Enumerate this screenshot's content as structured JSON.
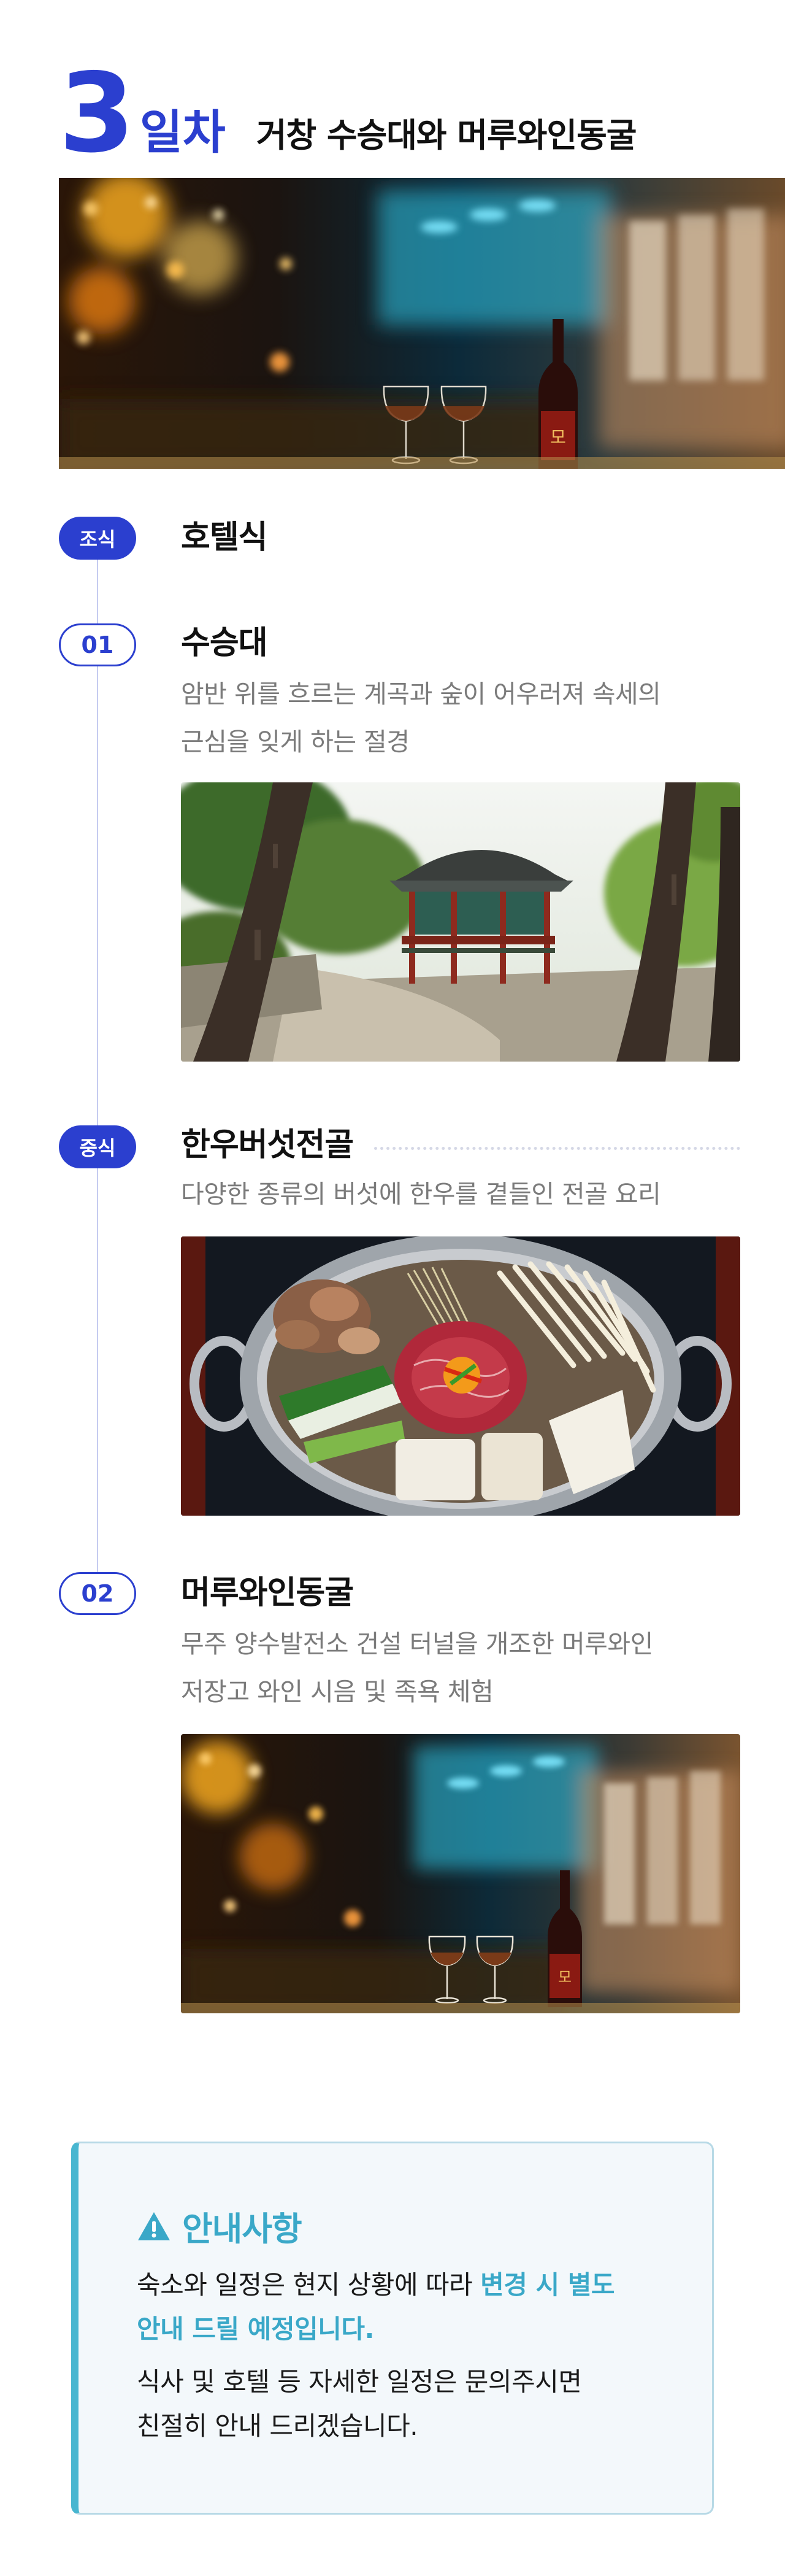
{
  "day": {
    "number": "3",
    "label": "일차",
    "title": "거창 수승대와 머루와인동굴"
  },
  "timeline": {
    "breakfast": {
      "badge": "조식",
      "title": "호텔식"
    },
    "stop1": {
      "badge": "01",
      "title": "수승대",
      "desc_line1": "암반 위를 흐르는 계곡과 숲이 어우러져 속세의",
      "desc_line2": "근심을 잊게 하는 절경"
    },
    "lunch": {
      "badge": "중식",
      "title": "한우버섯전골",
      "desc_line1": "다양한 종류의 버섯에 한우를 곁들인 전골 요리"
    },
    "stop2": {
      "badge": "02",
      "title": "머루와인동굴",
      "desc_line1": "무주 양수발전소 건설 터널을 개조한 머루와인",
      "desc_line2": "저장고 와인 시음 및 족욕 체험"
    }
  },
  "notice": {
    "icon": "warning-icon",
    "title": "안내사항",
    "line1_prefix": "숙소와 일정은 현지 상황에 따라 ",
    "line1_highlight": "변경 시 별도",
    "line2_highlight": "안내 드릴 예정입니다.",
    "line3": "식사 및 호텔 등 자세한 일정은 문의주시면",
    "line4": "친절히 안내 드리겠습니다."
  },
  "colors": {
    "accent": "#2b3fcf",
    "notice_accent": "#3aa8c8",
    "notice_bg": "#f3f8fb"
  }
}
